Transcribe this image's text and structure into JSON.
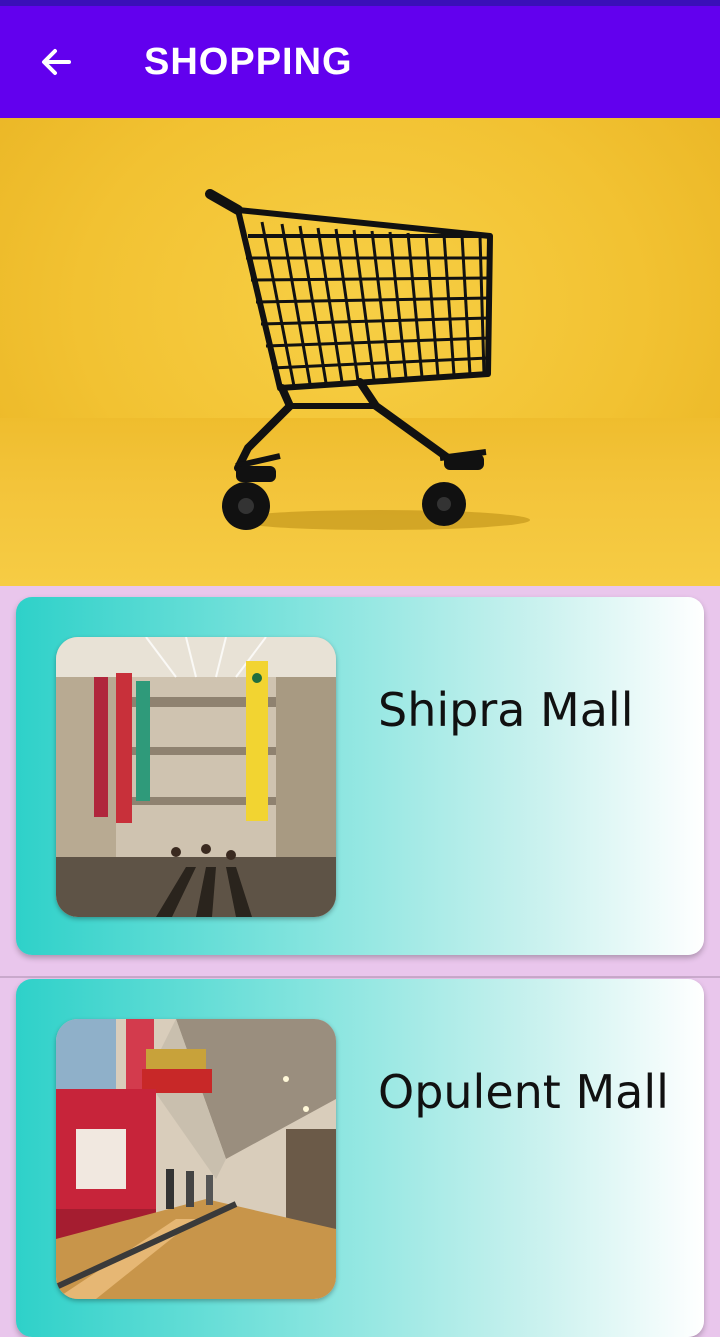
{
  "app_bar": {
    "title": "SHOPPING",
    "back_icon": "arrow-back-icon"
  },
  "colors": {
    "app_bar": "#6200ee",
    "background": "#e9c6ec",
    "hero_yellow": "#f2c232",
    "card_gradient_start": "#2ed1c9",
    "card_gradient_end": "#ffffff"
  },
  "hero": {
    "image": "shopping-cart-image"
  },
  "malls": [
    {
      "name": "Shipra Mall",
      "image": "shipra-mall-photo"
    },
    {
      "name": "Opulent Mall",
      "image": "opulent-mall-photo"
    }
  ]
}
